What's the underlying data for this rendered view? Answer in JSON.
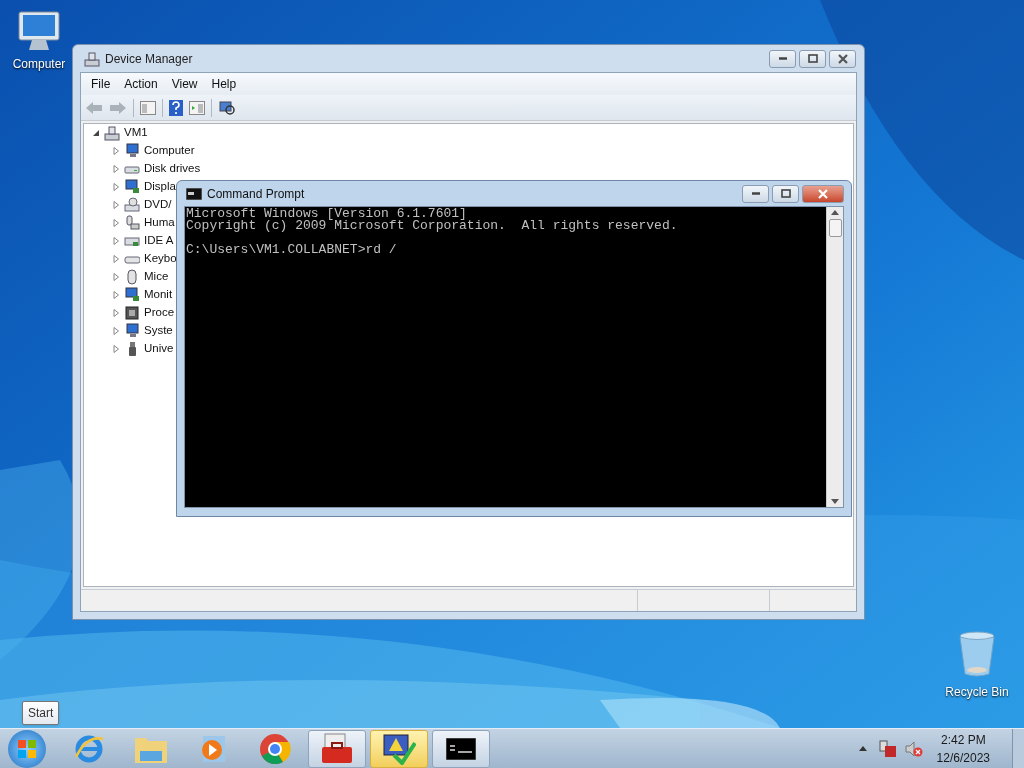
{
  "desktop_icons": [
    {
      "kind": "computer",
      "label": "Computer"
    },
    {
      "kind": "recycle",
      "label": "Recycle Bin"
    }
  ],
  "device_manager": {
    "title": "Device Manager",
    "menu": [
      "File",
      "Action",
      "View",
      "Help"
    ],
    "tree": {
      "label": "VM1",
      "expanded": true,
      "children": [
        {
          "kind": "computer",
          "label": "Computer",
          "expanded": false
        },
        {
          "kind": "disk",
          "label": "Disk drives",
          "expanded": false
        },
        {
          "kind": "display",
          "label": "Displa",
          "expanded": false
        },
        {
          "kind": "dvd",
          "label": "DVD/",
          "expanded": false
        },
        {
          "kind": "hid",
          "label": "Huma",
          "expanded": false
        },
        {
          "kind": "ide",
          "label": "IDE A",
          "expanded": false
        },
        {
          "kind": "keyboard",
          "label": "Keybo",
          "expanded": false
        },
        {
          "kind": "mouse",
          "label": "Mice",
          "expanded": false
        },
        {
          "kind": "display",
          "label": "Monit",
          "expanded": false
        },
        {
          "kind": "chip",
          "label": "Proce",
          "expanded": false
        },
        {
          "kind": "computer",
          "label": "Syste",
          "expanded": false
        },
        {
          "kind": "usb",
          "label": "Unive",
          "expanded": false
        }
      ]
    }
  },
  "command_prompt": {
    "title": "Command Prompt",
    "lines": [
      "Microsoft Windows [Version 6.1.7601]",
      "Copyright (c) 2009 Microsoft Corporation.  All rights reserved."
    ],
    "prompt": "C:\\Users\\VM1.COLLABNET>rd /"
  },
  "tooltip": "Start",
  "taskbar": {
    "buttons": [
      {
        "kind": "ie",
        "open": false,
        "highlighted": false
      },
      {
        "kind": "folder",
        "open": false,
        "highlighted": false
      },
      {
        "kind": "media",
        "open": false,
        "highlighted": false
      },
      {
        "kind": "chrome",
        "open": false,
        "highlighted": false
      },
      {
        "kind": "toolbox",
        "open": true,
        "highlighted": false
      },
      {
        "kind": "action-center",
        "open": true,
        "highlighted": true
      },
      {
        "kind": "console",
        "open": true,
        "highlighted": false
      }
    ],
    "time": "2:42 PM",
    "date": "12/6/2023"
  }
}
